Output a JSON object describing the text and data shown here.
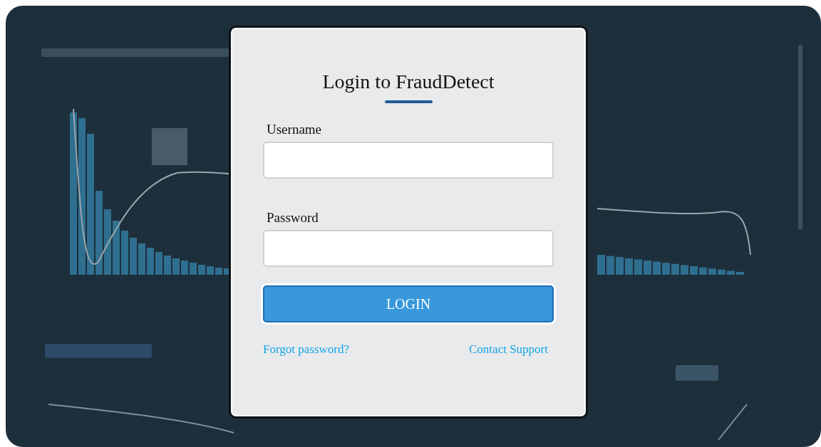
{
  "login": {
    "title": "Login to FraudDetect",
    "fields": [
      {
        "label": "Username"
      },
      {
        "label": "Password"
      }
    ],
    "button": "LOGIN",
    "links": [
      "Forgot password?",
      "Contact Support"
    ]
  }
}
